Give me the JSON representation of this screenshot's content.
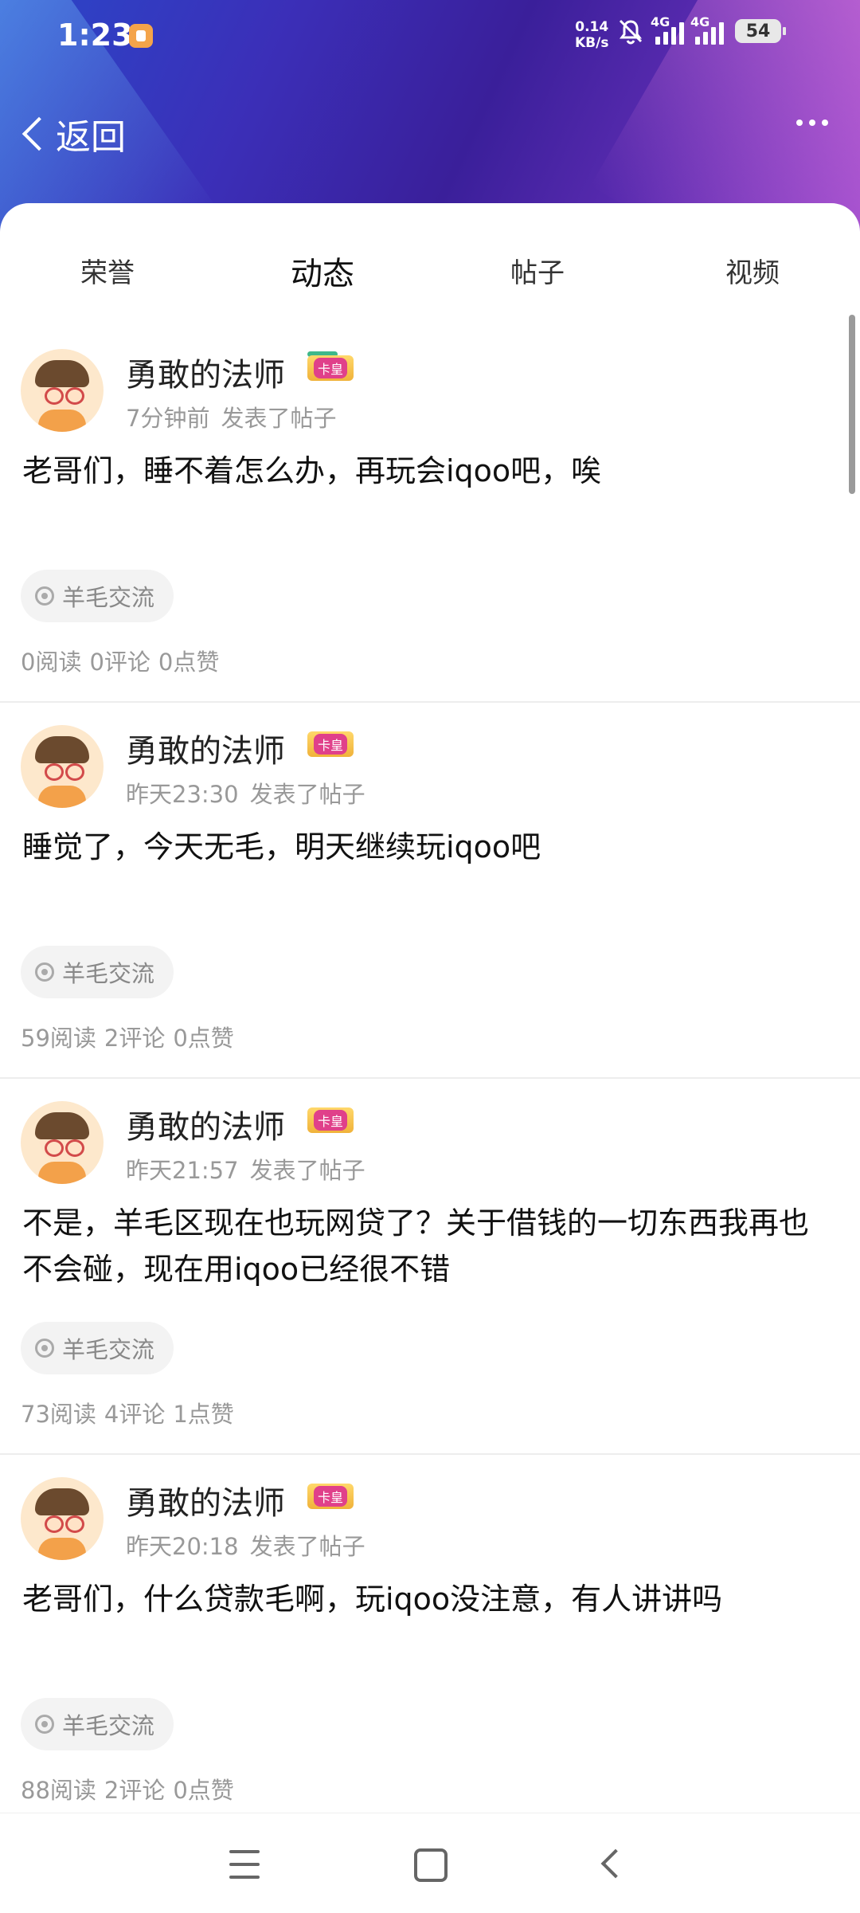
{
  "status_bar": {
    "time": "1:23",
    "net_speed_value": "0.14",
    "net_speed_unit": "KB/s",
    "signal_1_label": "4G",
    "signal_2_label": "4G",
    "battery": "54"
  },
  "header": {
    "back_label": "返回"
  },
  "tabs": [
    {
      "label": "荣誉",
      "active": false
    },
    {
      "label": "动态",
      "active": true
    },
    {
      "label": "帖子",
      "active": false
    },
    {
      "label": "视频",
      "active": false
    }
  ],
  "posts": [
    {
      "author": "勇敢的法师",
      "badge": "卡皇",
      "time": "7分钟前",
      "action": "发表了帖子",
      "content": "老哥们，睡不着怎么办，再玩会iqoo吧，唉",
      "tag": "羊毛交流",
      "reads": "0阅读",
      "comments": "0评论",
      "likes": "0点赞"
    },
    {
      "author": "勇敢的法师",
      "badge": "卡皇",
      "time": "昨天23:30",
      "action": "发表了帖子",
      "content": "睡觉了，今天无毛，明天继续玩iqoo吧",
      "tag": "羊毛交流",
      "reads": "59阅读",
      "comments": "2评论",
      "likes": "0点赞"
    },
    {
      "author": "勇敢的法师",
      "badge": "卡皇",
      "time": "昨天21:57",
      "action": "发表了帖子",
      "content": "不是，羊毛区现在也玩网贷了？关于借钱的一切东西我再也不会碰，现在用iqoo已经很不错",
      "tag": "羊毛交流",
      "reads": "73阅读",
      "comments": "4评论",
      "likes": "1点赞"
    },
    {
      "author": "勇敢的法师",
      "badge": "卡皇",
      "time": "昨天20:18",
      "action": "发表了帖子",
      "content": "老哥们，什么贷款毛啊，玩iqoo没注意，有人讲讲吗",
      "tag": "羊毛交流",
      "reads": "88阅读",
      "comments": "2评论",
      "likes": "0点赞"
    }
  ],
  "colors": {
    "accent": "#3fb88a",
    "header_gradient_start": "#2a47c9",
    "header_gradient_end": "#8a3fc8"
  },
  "icons": [
    "back-chevron-icon",
    "more-dots-icon",
    "bell-off-icon",
    "signal-icon",
    "battery-icon",
    "tag-target-icon",
    "nav-menu-icon",
    "nav-home-icon",
    "nav-back-icon"
  ]
}
